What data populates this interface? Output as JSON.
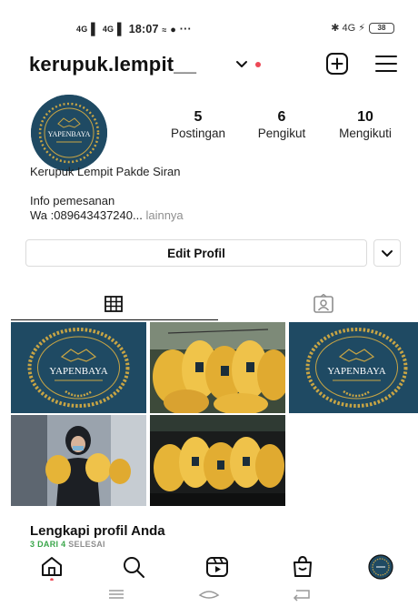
{
  "status_bar": {
    "signal_1": "4G",
    "signal_2": "4G",
    "time": "18:07",
    "extras": "···",
    "right_icons": "✱ 4G ⚡",
    "battery": "38"
  },
  "header": {
    "username": "kerupuk.lempit__"
  },
  "profile": {
    "avatar_text": "YAPENBAYA",
    "stats": [
      {
        "value": "5",
        "label": "Postingan"
      },
      {
        "value": "6",
        "label": "Pengikut"
      },
      {
        "value": "10",
        "label": "Mengikuti"
      }
    ],
    "full_name": "Kerupuk Lempit Pakde Siran",
    "bio_line1": "Info pemesanan",
    "bio_line2": "Wa :089643437240...",
    "more_label": "lainnya",
    "edit_label": "Edit Profil"
  },
  "grid": {
    "logo_text": "YAPENBAYA"
  },
  "completion": {
    "title": "Lengkapi profil Anda",
    "progress_done": "3 DARI 4",
    "progress_rest": "SELESAI"
  },
  "colors": {
    "accent_red": "#ed4956",
    "logo_bg": "#1f4a63",
    "logo_gold": "#c9a544",
    "progress_green": "#3aa64a"
  }
}
